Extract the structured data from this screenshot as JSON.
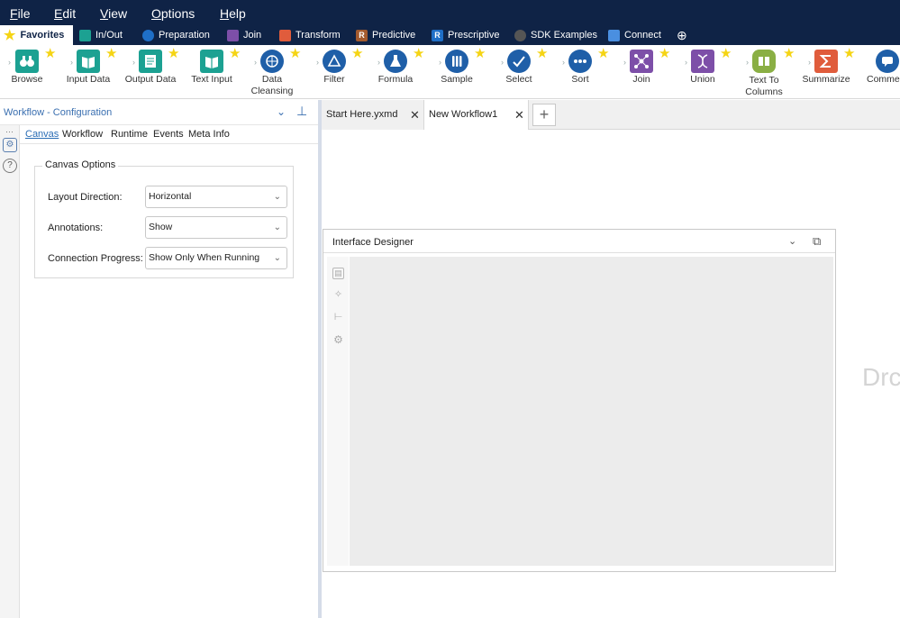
{
  "menu": [
    {
      "name": "menu-file",
      "label": "File"
    },
    {
      "name": "menu-edit",
      "label": "Edit"
    },
    {
      "name": "menu-view",
      "label": "View"
    },
    {
      "name": "menu-options",
      "label": "Options"
    },
    {
      "name": "menu-help",
      "label": "Help"
    }
  ],
  "categories": [
    {
      "label": "Favorites",
      "color": "#f5d414",
      "active": true,
      "icon": "star-icon"
    },
    {
      "label": "In/Out",
      "color": "#1ca192",
      "icon": "folder-icon"
    },
    {
      "label": "Preparation",
      "color": "#1f6fc7",
      "icon": "circle-icon"
    },
    {
      "label": "Join",
      "color": "#7d4fa8",
      "icon": "square-icon"
    },
    {
      "label": "Transform",
      "color": "#e05c3c",
      "icon": "square-icon"
    },
    {
      "label": "Predictive",
      "color": "#a35a2e",
      "badge": "R",
      "icon": "r-icon"
    },
    {
      "label": "Prescriptive",
      "color": "#1f6fc7",
      "badge": "R",
      "icon": "r-icon"
    },
    {
      "label": "SDK Examples",
      "color": "#555555",
      "icon": "circle-icon"
    },
    {
      "label": "Connect",
      "color": "#4a8fe0",
      "icon": "folder-icon"
    }
  ],
  "add_category_icon": "⊕",
  "tools": [
    {
      "label": "Browse",
      "color": "#1ca192",
      "icon": "binoculars-icon"
    },
    {
      "label": "Input Data",
      "color": "#1ca192",
      "icon": "book-icon"
    },
    {
      "label": "Output Data",
      "color": "#1ca192",
      "icon": "document-icon"
    },
    {
      "label": "Text Input",
      "color": "#1ca192",
      "icon": "book-icon"
    },
    {
      "label": "Data Cleansing",
      "color": "#1f5fa8",
      "icon": "globe-icon"
    },
    {
      "label": "Filter",
      "color": "#1f5fa8",
      "icon": "triangle-icon"
    },
    {
      "label": "Formula",
      "color": "#1f5fa8",
      "icon": "flask-icon"
    },
    {
      "label": "Sample",
      "color": "#1f5fa8",
      "icon": "tubes-icon"
    },
    {
      "label": "Select",
      "color": "#1f5fa8",
      "icon": "check-icon"
    },
    {
      "label": "Sort",
      "color": "#1f5fa8",
      "icon": "dots-icon"
    },
    {
      "label": "Join",
      "color": "#7d4fa8",
      "icon": "network-icon"
    },
    {
      "label": "Union",
      "color": "#7d4fa8",
      "icon": "dna-icon"
    },
    {
      "label": "Text To Columns",
      "color": "#8aaf44",
      "icon": "columns-icon"
    },
    {
      "label": "Summarize",
      "color": "#e05c3c",
      "icon": "sigma-icon"
    },
    {
      "label": "Comment",
      "color": "#1f5fa8",
      "icon": "speech-icon"
    }
  ],
  "config": {
    "title": "Workflow - Configuration",
    "tabs": [
      "Canvas",
      "Workflow",
      "Runtime",
      "Events",
      "Meta Info"
    ],
    "active_tab": "Canvas",
    "group_title": "Canvas Options",
    "rows": [
      {
        "label": "Layout Direction:",
        "value": "Horizontal"
      },
      {
        "label": "Annotations:",
        "value": "Show"
      },
      {
        "label": "Connection Progress:",
        "value": "Show Only When Running"
      }
    ]
  },
  "workflow_tabs": [
    {
      "label": "Start Here.yxmd",
      "active": false
    },
    {
      "label": "New Workflow1",
      "active": true
    }
  ],
  "canvas": {
    "drop_text": "Drc"
  },
  "interface_designer": {
    "title": "Interface Designer"
  }
}
